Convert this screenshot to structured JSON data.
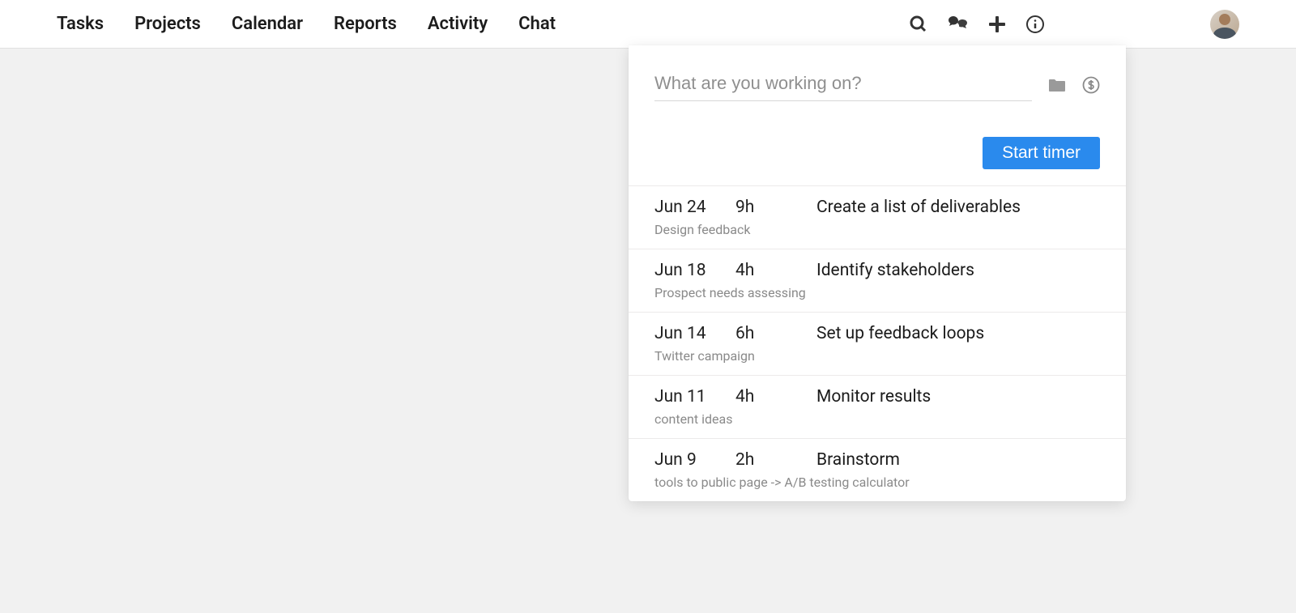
{
  "nav": {
    "items": [
      "Tasks",
      "Projects",
      "Calendar",
      "Reports",
      "Activity",
      "Chat"
    ]
  },
  "timer": {
    "placeholder": "What are you working on?",
    "start_label": "Start timer"
  },
  "entries": [
    {
      "date": "Jun 24",
      "duration": "9h",
      "description": "Create a list of deliverables",
      "project": "Design feedback"
    },
    {
      "date": "Jun 18",
      "duration": "4h",
      "description": "Identify stakeholders",
      "project": "Prospect needs assessing"
    },
    {
      "date": "Jun 14",
      "duration": "6h",
      "description": "Set up feedback loops",
      "project": "Twitter campaign"
    },
    {
      "date": "Jun 11",
      "duration": "4h",
      "description": "Monitor results",
      "project": "content ideas"
    },
    {
      "date": "Jun 9",
      "duration": "2h",
      "description": "Brainstorm",
      "project": "tools to public page -> A/B testing calculator"
    }
  ]
}
